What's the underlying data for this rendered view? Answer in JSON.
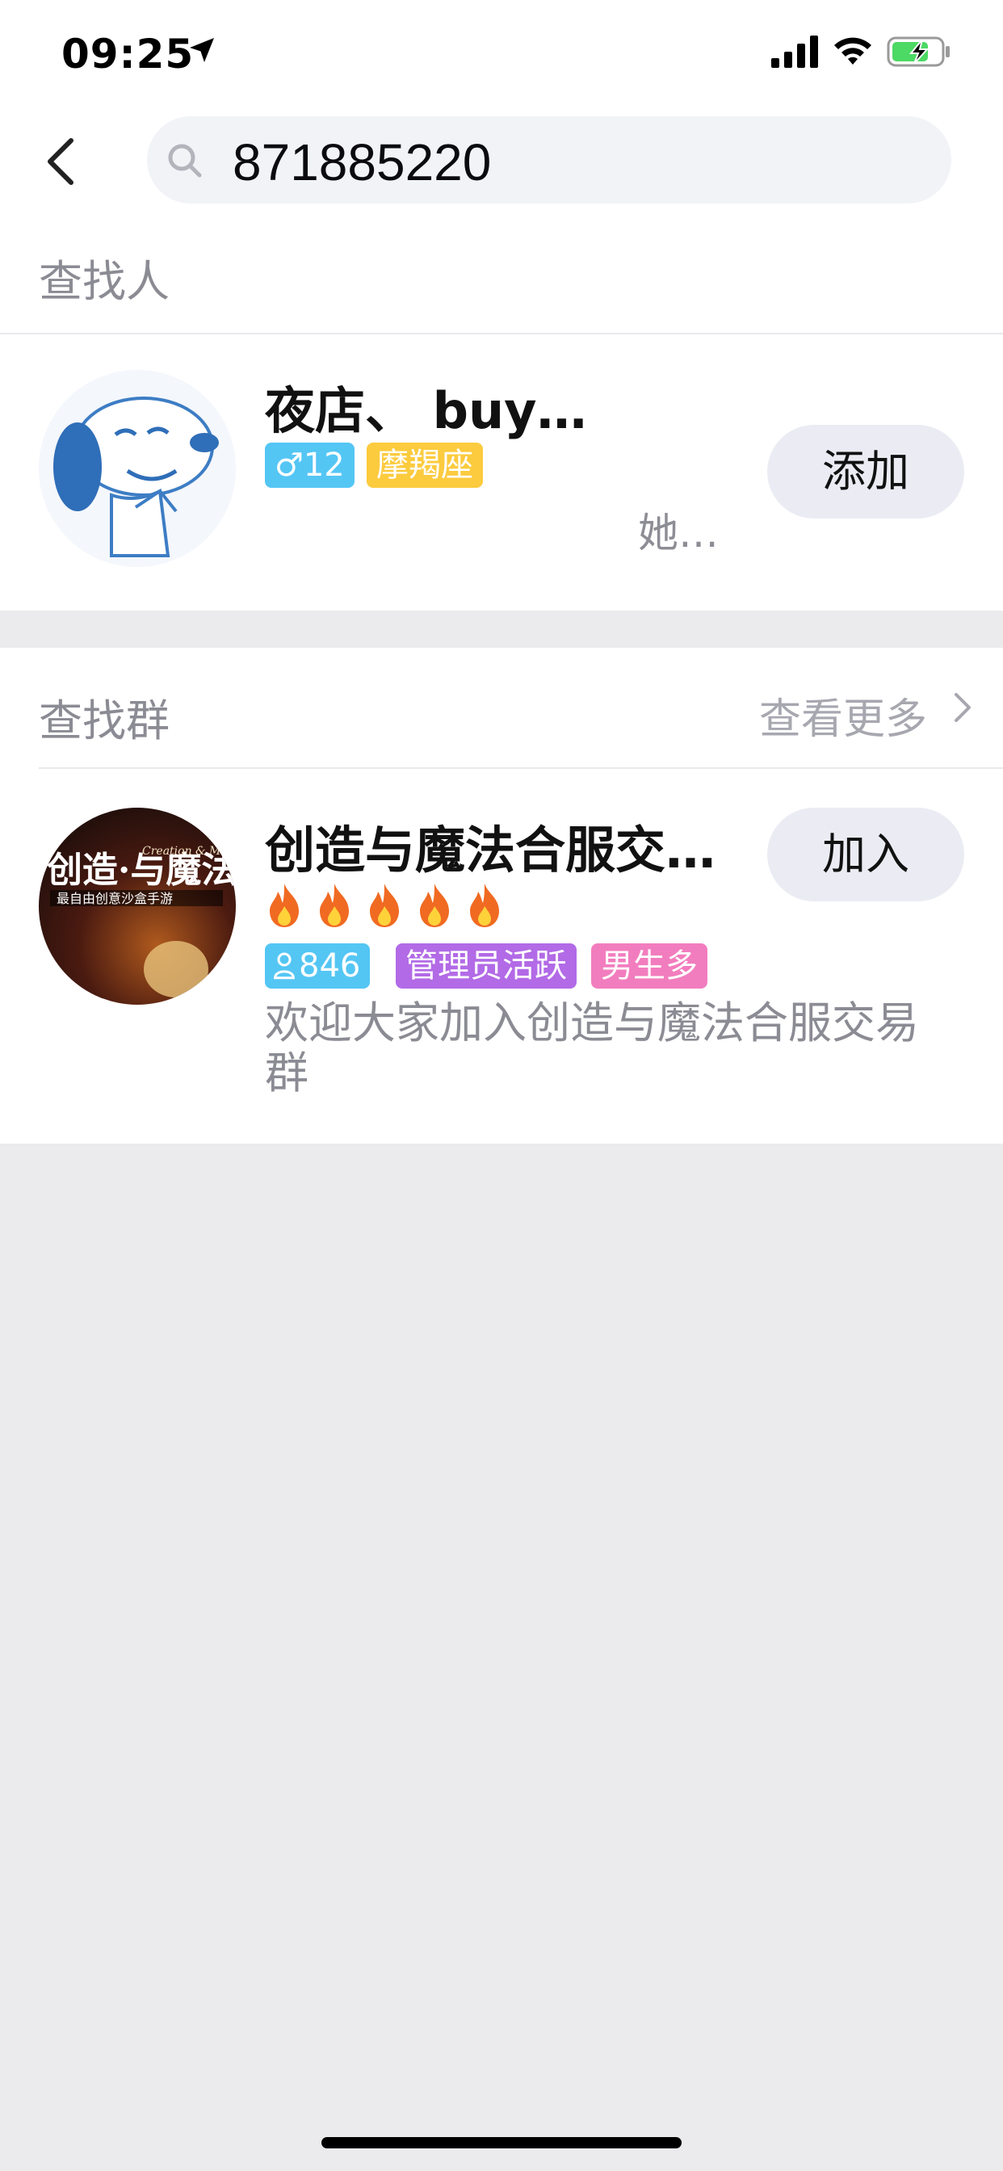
{
  "status_bar": {
    "time": "09:25"
  },
  "search": {
    "query": "871885220"
  },
  "people_section": {
    "title": "查找人",
    "result": {
      "name": "夜店、 buy…",
      "gender_age": "♂12",
      "zodiac": "摩羯座",
      "status": "她…",
      "action_label": "添加"
    }
  },
  "group_section": {
    "title": "查找群",
    "more_label": "查看更多",
    "result": {
      "name": "创造与魔法合服交…",
      "flame_count": 5,
      "member_count": "846",
      "tag_admin": "管理员活跃",
      "tag_gender": "男生多",
      "description": "欢迎大家加入创造与魔法合服交易群",
      "action_label": "加入",
      "avatar_text_main": "创造·与魔法",
      "avatar_text_en": "Creation & Magic",
      "avatar_text_sub": "最自由创意沙盒手游"
    }
  },
  "colors": {
    "tag_blue": "#54c6f4",
    "tag_yellow": "#fccb3e",
    "tag_purple": "#b26ae6",
    "tag_pink": "#f27dbe",
    "flame": "#f06a22"
  }
}
